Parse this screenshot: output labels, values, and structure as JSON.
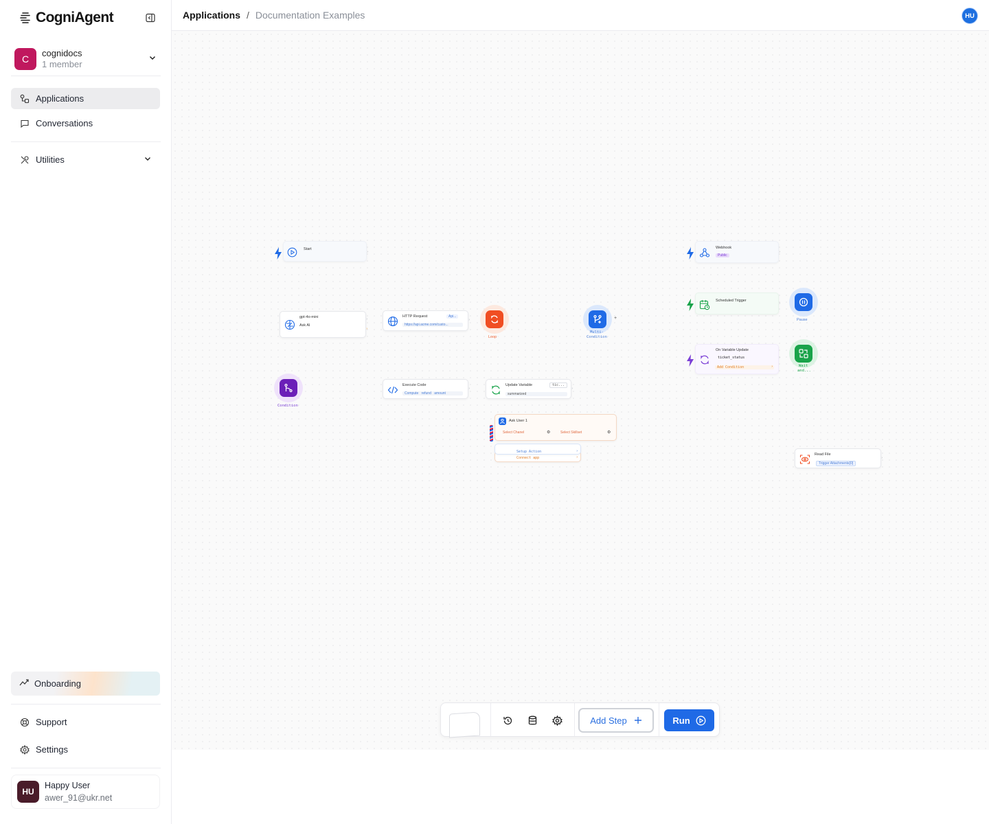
{
  "app": {
    "name": "CogniAgent"
  },
  "workspace": {
    "initial": "C",
    "name": "cognidocs",
    "members": "1 member"
  },
  "nav": {
    "applications": "Applications",
    "conversations": "Conversations",
    "utilities": "Utilities",
    "onboarding": "Onboarding",
    "support": "Support",
    "settings": "Settings"
  },
  "user": {
    "initials": "HU",
    "name": "Happy User",
    "email": "awer_91@ukr.net"
  },
  "breadcrumb": {
    "root": "Applications",
    "current": "Documentation Examples"
  },
  "header": {
    "avatar_initials": "HU"
  },
  "canvas": {
    "nodes": {
      "start": {
        "title": "Start"
      },
      "webhook": {
        "title": "Webhook",
        "badge": "Public"
      },
      "ask_ai": {
        "model": "gpt-4o-mini",
        "title": "Ask AI"
      },
      "http": {
        "title": "HTTP Request",
        "badge": "Api...",
        "url": "https://api.acme.com/custo..."
      },
      "loop": {
        "label": "Loop"
      },
      "multi": {
        "label_1": "Multi-",
        "label_2": "Condition"
      },
      "scheduled": {
        "title": "Scheduled Trigger"
      },
      "pause": {
        "label": "Pause"
      },
      "var_update": {
        "title": "On Variable Update",
        "variable": "ticket_status",
        "action": "Add Condition"
      },
      "wait": {
        "label_1": "Wait",
        "label_2": "and..."
      },
      "condition": {
        "label": "Condition"
      },
      "exec_code": {
        "title": "Execute Code",
        "desc": "Compute refund amount"
      },
      "update_var": {
        "title": "Update Variable",
        "badge": "tic...",
        "value": "summarized"
      },
      "ask_user": {
        "title": "Ask User 1",
        "channel": "Select Chanel",
        "skillset": "Select Skillset",
        "setup": "Setup Action",
        "connect": "Connect app"
      },
      "read_file": {
        "title": "Read File",
        "file": "Trigger Attachments[0]"
      }
    }
  },
  "toolbar": {
    "add_step": "Add Step",
    "run": "Run"
  },
  "colors": {
    "accent": "#1f6ae6",
    "workspace": "#c0185e",
    "loop": "#f04e23",
    "condition": "#6b1fb8",
    "wait": "#19a34a"
  }
}
